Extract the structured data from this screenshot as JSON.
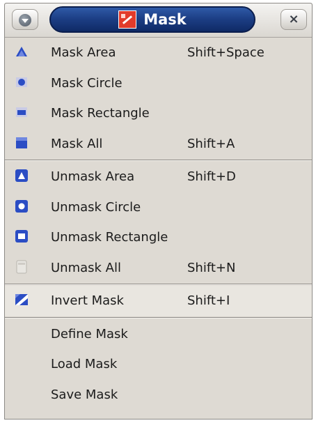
{
  "window": {
    "title": "Mask",
    "close_glyph": "×"
  },
  "menu": {
    "groups": [
      [
        {
          "label": "Mask Area",
          "shortcut": "Shift+Space",
          "icon": "mask-area-icon"
        },
        {
          "label": "Mask Circle",
          "shortcut": "",
          "icon": "mask-circle-icon"
        },
        {
          "label": "Mask Rectangle",
          "shortcut": "",
          "icon": "mask-rectangle-icon"
        },
        {
          "label": "Mask All",
          "shortcut": "Shift+A",
          "icon": "mask-all-icon"
        }
      ],
      [
        {
          "label": "Unmask Area",
          "shortcut": "Shift+D",
          "icon": "unmask-area-icon"
        },
        {
          "label": "Unmask Circle",
          "shortcut": "",
          "icon": "unmask-circle-icon"
        },
        {
          "label": "Unmask Rectangle",
          "shortcut": "",
          "icon": "unmask-rectangle-icon"
        },
        {
          "label": "Unmask All",
          "shortcut": "Shift+N",
          "icon": "unmask-all-icon"
        }
      ],
      [
        {
          "label": "Invert Mask",
          "shortcut": "Shift+I",
          "icon": "invert-mask-icon"
        }
      ],
      [
        {
          "label": "Define Mask",
          "shortcut": "",
          "icon": ""
        },
        {
          "label": "Load Mask",
          "shortcut": "",
          "icon": ""
        },
        {
          "label": "Save Mask",
          "shortcut": "",
          "icon": ""
        }
      ]
    ]
  },
  "colors": {
    "title_bar_pill": "#1d3f86",
    "menu_background": "#dedad3",
    "icon_blue": "#2b4dc4",
    "icon_red": "#e23b2b"
  }
}
